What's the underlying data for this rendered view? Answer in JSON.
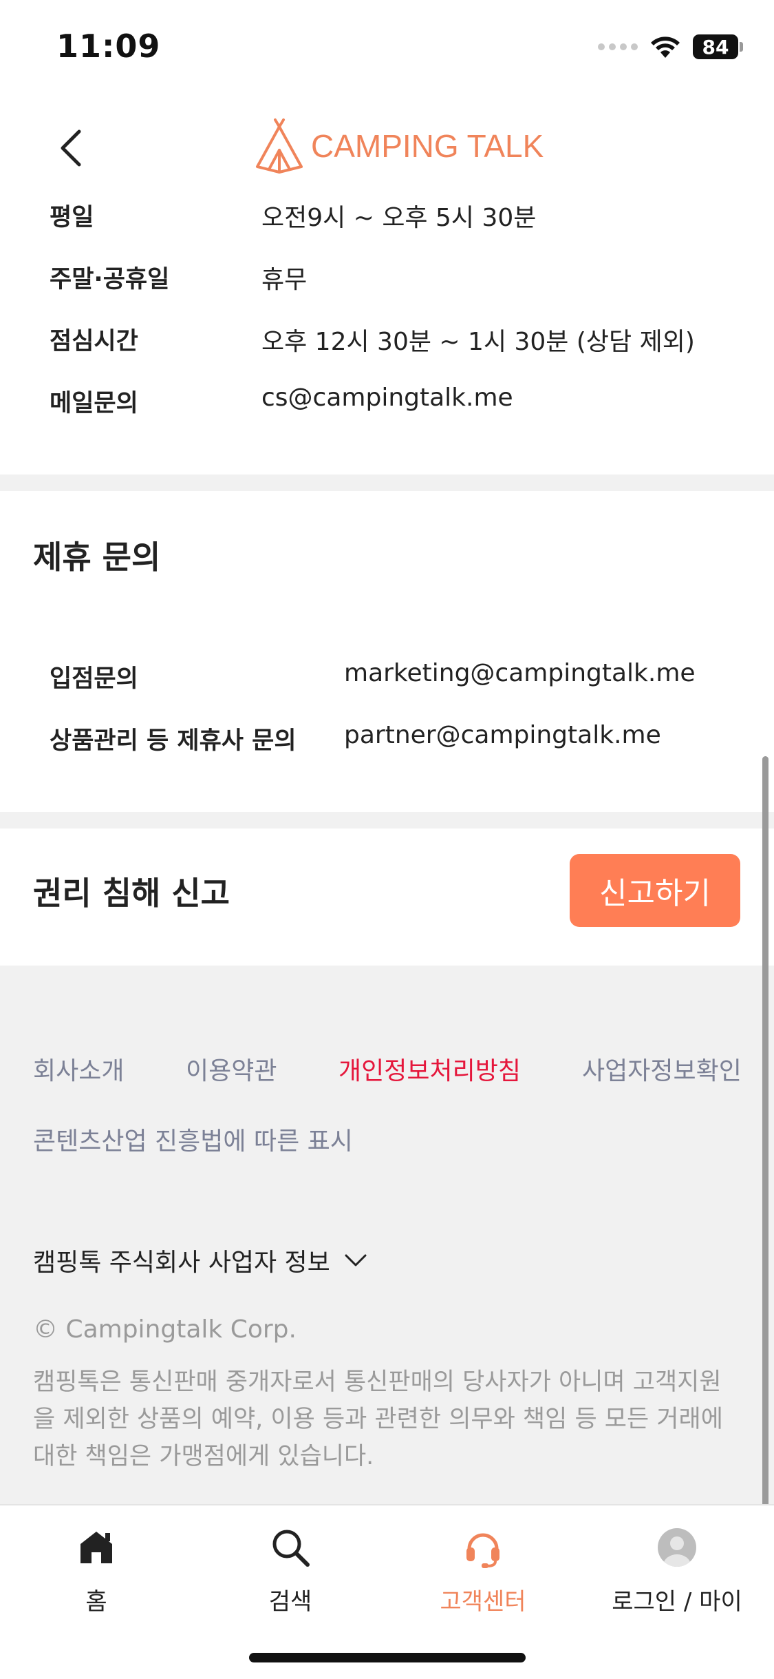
{
  "status_bar": {
    "time": "11:09",
    "battery": "84"
  },
  "header": {
    "logo_text": "CAMPING TALK"
  },
  "hours": [
    {
      "label": "평일",
      "value": "오전9시 ~ 오후 5시 30분"
    },
    {
      "label": "주말·공휴일",
      "value": "휴무"
    },
    {
      "label": "점심시간",
      "value": "오후 12시 30분 ~ 1시 30분 (상담 제외)"
    },
    {
      "label": "메일문의",
      "value": "cs@campingtalk.me"
    }
  ],
  "partnership": {
    "title": "제휴 문의",
    "rows": [
      {
        "label": "입점문의",
        "value": "marketing@campingtalk.me"
      },
      {
        "label": "상품관리 등 제휴사 문의",
        "value": "partner@campingtalk.me"
      }
    ]
  },
  "report": {
    "title": "권리 침해 신고",
    "button": "신고하기"
  },
  "footer": {
    "links": [
      "회사소개",
      "이용약관",
      "개인정보처리방침",
      "사업자정보확인"
    ],
    "link_content": "콘텐츠산업 진흥법에 따른 표시",
    "biz_info_toggle": "캠핑톡 주식회사 사업자 정보",
    "copyright": "© Campingtalk Corp.",
    "disclaimer": "캠핑톡은 통신판매 중개자로서 통신판매의 당사자가 아니며 고객지원을 제외한 상품의 예약, 이용 등과 관련한 의무와 책임 등 모든 거래에 대한 책임은 가맹점에게 있습니다."
  },
  "tabs": [
    {
      "label": "홈",
      "icon": "home-icon"
    },
    {
      "label": "검색",
      "icon": "search-icon"
    },
    {
      "label": "고객센터",
      "icon": "headset-icon",
      "active": true
    },
    {
      "label": "로그인 / 마이",
      "icon": "avatar-icon"
    }
  ],
  "colors": {
    "accent": "#f0845a",
    "button": "#ff7e55",
    "active_link": "#e5163b"
  }
}
